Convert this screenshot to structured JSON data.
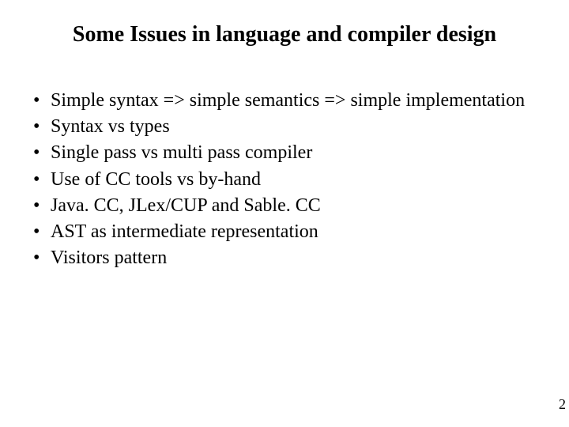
{
  "title": "Some Issues in language and compiler design",
  "bullets": [
    "Simple syntax => simple semantics => simple implementation",
    "Syntax vs types",
    "Single pass vs multi pass compiler",
    "Use of CC tools vs by-hand",
    "Java. CC, JLex/CUP and Sable. CC",
    "AST as intermediate representation",
    "Visitors pattern"
  ],
  "pageNumber": "2"
}
